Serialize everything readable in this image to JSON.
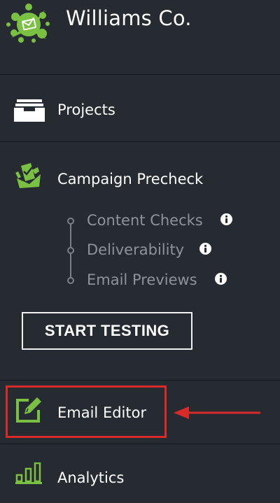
{
  "brand": {
    "name": "Williams Co.",
    "logo_icon": "paint-splat-logo",
    "logo_color": "#7ac143"
  },
  "nav": {
    "projects": {
      "label": "Projects",
      "icon": "inbox-tray-icon"
    },
    "campaign_precheck": {
      "label": "Campaign Precheck",
      "icon": "checklist-envelope-icon",
      "subitems": [
        {
          "label": "Content Checks"
        },
        {
          "label": "Deliverability"
        },
        {
          "label": "Email Previews"
        }
      ],
      "start_button": "START TESTING"
    },
    "email_editor": {
      "label": "Email Editor",
      "icon": "edit-pencil-icon"
    },
    "analytics": {
      "label": "Analytics",
      "icon": "bar-chart-icon"
    }
  },
  "colors": {
    "background": "#262a31",
    "accent_green": "#7ac143",
    "highlight_red": "#d92a2a",
    "subnav_text": "#8e939b"
  }
}
